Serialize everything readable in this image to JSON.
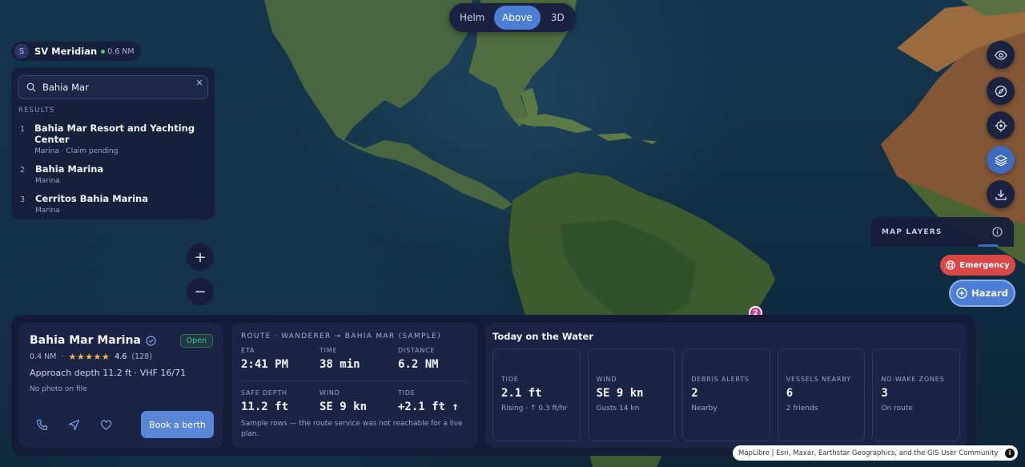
{
  "view_toggle": {
    "helm": "Helm",
    "above": "Above",
    "three_d": "3D",
    "selected": "Above"
  },
  "vessel": {
    "initial": "S",
    "name": "SV Meridian",
    "distance": "0.6 NM"
  },
  "search": {
    "value": "Bahia Mar",
    "results_heading": "RESULTS",
    "results": [
      {
        "num": "1",
        "title": "Bahia Mar Resort and Yachting Center",
        "sub": "Marina · Claim pending"
      },
      {
        "num": "2",
        "title": "Bahia Marina",
        "sub": "Marina"
      },
      {
        "num": "3",
        "title": "Cerritos Bahia Marina",
        "sub": "Marina"
      }
    ]
  },
  "zoom": {
    "in": "+",
    "out": "−"
  },
  "toolbar": {
    "icons": [
      "eye-icon",
      "compass-icon",
      "locate-icon",
      "layers-icon",
      "download-icon"
    ],
    "active": "layers-icon"
  },
  "map_layers": {
    "label": "MAP LAYERS"
  },
  "actions": {
    "emergency": "Emergency",
    "hazard": "Hazard"
  },
  "map_pin": {
    "label": "2"
  },
  "marina": {
    "title": "Bahia Mar Marina",
    "status": "Open",
    "distance": "0.4 NM",
    "rating": "4.6",
    "reviews": "(128)",
    "stars": 4.6,
    "approach": "Approach depth 11.2 ft · VHF 16/71",
    "photo_note": "No photo on file",
    "book": "Book a berth"
  },
  "route": {
    "heading": "ROUTE · WANDERER → BAHIA MAR (SAMPLE)",
    "eta_label": "ETA",
    "eta": "2:41 PM",
    "time_label": "TIME",
    "time": "38 min",
    "distance_label": "DISTANCE",
    "distance": "6.2 NM",
    "depth_label": "SAFE DEPTH",
    "depth": "11.2 ft",
    "wind_label": "WIND",
    "wind": "SE 9 kn",
    "tide_label": "TIDE",
    "tide": "+2.1 ft ↑",
    "note": "Sample rows — the route service was not reachable for a live plan."
  },
  "today": {
    "heading": "Today on the Water",
    "stats": [
      {
        "label": "TIDE",
        "value": "2.1 ft",
        "sub": "Rising · ↑ 0.3 ft/hr"
      },
      {
        "label": "WIND",
        "value": "SE 9 kn",
        "sub": "Gusts 14 kn"
      },
      {
        "label": "DEBRIS ALERTS",
        "value": "2",
        "sub": "Nearby"
      },
      {
        "label": "VESSELS NEARBY",
        "value": "6",
        "sub": "2 friends"
      },
      {
        "label": "NO-WAKE ZONES",
        "value": "3",
        "sub": "On route"
      }
    ]
  },
  "attribution": {
    "lib": "MapLibre",
    "text": " | Esri, Maxar, Earthstar Geographics, and the GIS User Community",
    "info": "i"
  },
  "colors": {
    "accent": "#4c7fd4",
    "emergency": "#d94747",
    "open": "#4ec17f",
    "star": "#f2b84b",
    "pin": "#d4388e"
  }
}
